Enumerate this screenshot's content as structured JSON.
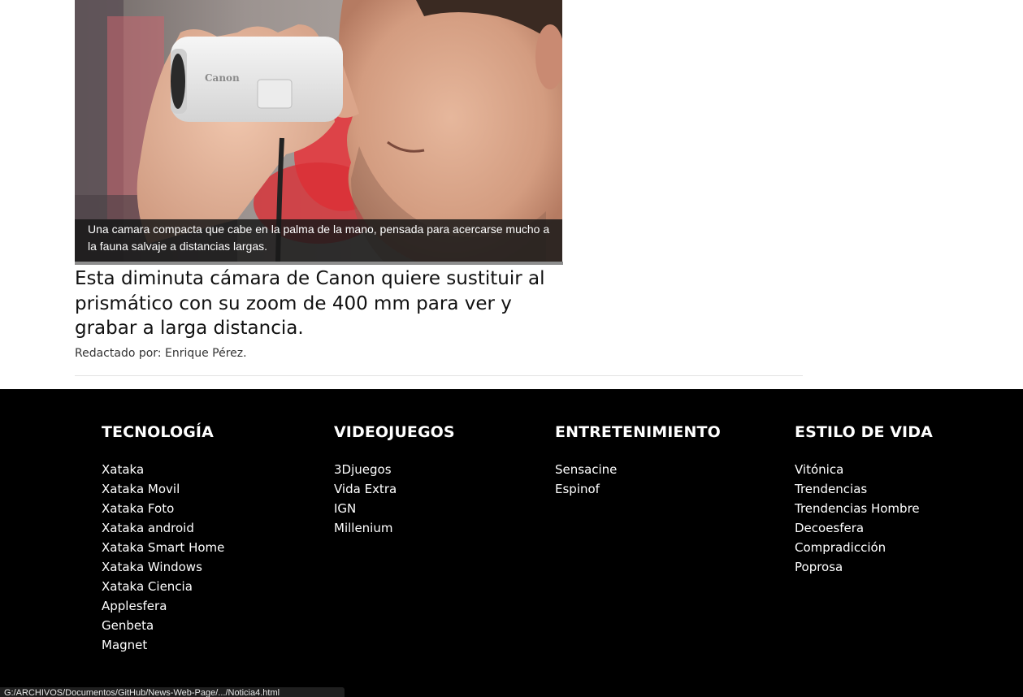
{
  "article": {
    "image_alt_icon": "photo-icon",
    "caption": "Una camara compacta que cabe en la palma de la mano, pensada para acercarse mucho a la fauna salvaje a distancias largas.",
    "camera_brand": "Canon",
    "headline": "Esta diminuta cámara de Canon quiere sustituir al prismático con su zoom de 400 mm para ver y grabar a larga distancia.",
    "byline": "Redactado por: Enrique Pérez."
  },
  "footer": {
    "columns": [
      {
        "heading": "TECNOLOGÍA",
        "links": [
          "Xataka",
          "Xataka Movil",
          "Xataka Foto",
          "Xataka android",
          "Xataka Smart Home",
          "Xataka Windows",
          "Xataka Ciencia",
          "Applesfera",
          "Genbeta",
          "Magnet"
        ]
      },
      {
        "heading": "VIDEOJUEGOS",
        "links": [
          "3Djuegos",
          "Vida Extra",
          "IGN",
          "Millenium"
        ]
      },
      {
        "heading": "ENTRETENIMIENTO",
        "links": [
          "Sensacine",
          "Espinof"
        ]
      },
      {
        "heading": "ESTILO DE VIDA",
        "links": [
          "Vitónica",
          "Trendencias",
          "Trendencias Hombre",
          "Decoesfera",
          "Compradicción",
          "Poprosa"
        ]
      }
    ]
  },
  "statusbar": {
    "url": "G:/ARCHIVOS/Documentos/GitHub/News-Web-Page/.../Noticia4.html"
  },
  "colors": {
    "footer_bg": "#000000",
    "page_bg": "#ffffff",
    "caption_bg": "#191919"
  }
}
